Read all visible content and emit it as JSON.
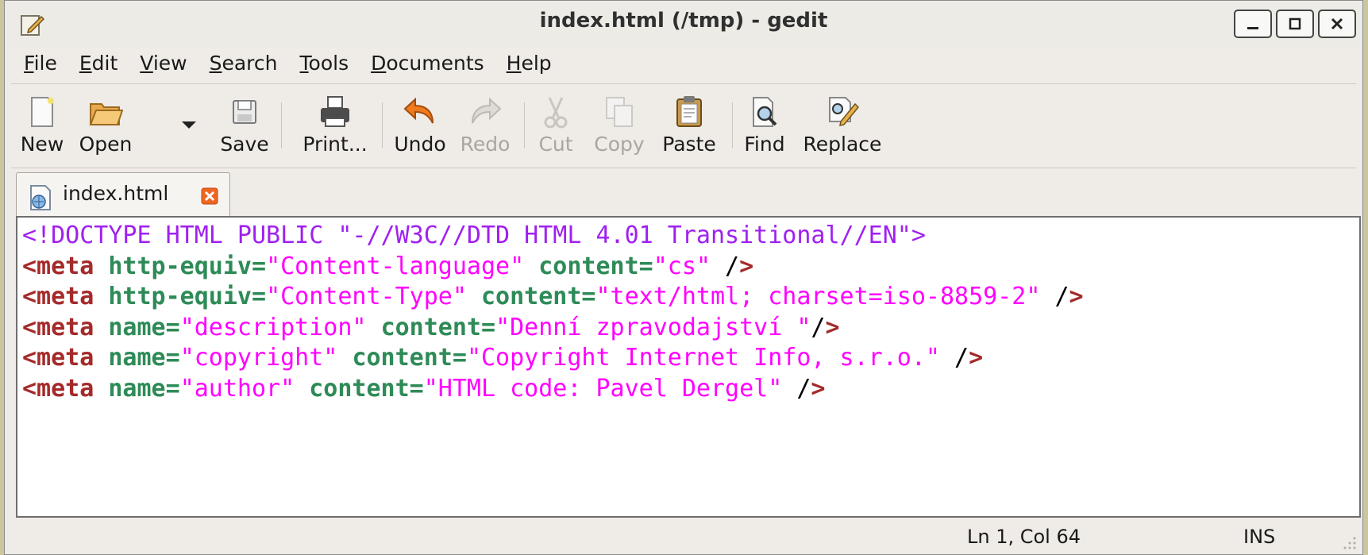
{
  "window": {
    "title": "index.html (/tmp) - gedit"
  },
  "menubar": {
    "items": [
      {
        "pre": "",
        "key": "F",
        "rest": "ile"
      },
      {
        "pre": "",
        "key": "E",
        "rest": "dit"
      },
      {
        "pre": "",
        "key": "V",
        "rest": "iew"
      },
      {
        "pre": "",
        "key": "S",
        "rest": "earch"
      },
      {
        "pre": "",
        "key": "T",
        "rest": "ools"
      },
      {
        "pre": "",
        "key": "D",
        "rest": "ocuments"
      },
      {
        "pre": "",
        "key": "H",
        "rest": "elp"
      }
    ]
  },
  "toolbar": {
    "new": "New",
    "open": "Open",
    "save": "Save",
    "print": "Print...",
    "undo": "Undo",
    "redo": "Redo",
    "cut": "Cut",
    "copy": "Copy",
    "paste": "Paste",
    "find": "Find",
    "replace": "Replace"
  },
  "tabs": [
    {
      "label": "index.html"
    }
  ],
  "editor": {
    "lines": [
      [
        {
          "t": "doc",
          "v": "<!DOCTYPE HTML PUBLIC \"-//W3C//DTD HTML 4.01 Transitional//EN\">"
        }
      ],
      [
        {
          "t": "tag",
          "v": "<meta"
        },
        {
          "t": "p",
          "v": " "
        },
        {
          "t": "attr",
          "v": "http-equiv="
        },
        {
          "t": "str",
          "v": "\"Content-language\""
        },
        {
          "t": "p",
          "v": " "
        },
        {
          "t": "attr",
          "v": "content="
        },
        {
          "t": "str",
          "v": "\"cs\""
        },
        {
          "t": "p",
          "v": " /"
        },
        {
          "t": "tag",
          "v": ">"
        }
      ],
      [
        {
          "t": "tag",
          "v": "<meta"
        },
        {
          "t": "p",
          "v": " "
        },
        {
          "t": "attr",
          "v": "http-equiv="
        },
        {
          "t": "str",
          "v": "\"Content-Type\""
        },
        {
          "t": "p",
          "v": " "
        },
        {
          "t": "attr",
          "v": "content="
        },
        {
          "t": "str",
          "v": "\"text/html; charset=iso-8859-2\""
        },
        {
          "t": "p",
          "v": " /"
        },
        {
          "t": "tag",
          "v": ">"
        }
      ],
      [
        {
          "t": "tag",
          "v": "<meta"
        },
        {
          "t": "p",
          "v": " "
        },
        {
          "t": "attr",
          "v": "name="
        },
        {
          "t": "str",
          "v": "\"description\""
        },
        {
          "t": "p",
          "v": " "
        },
        {
          "t": "attr",
          "v": "content="
        },
        {
          "t": "str",
          "v": "\"Denní zpravodajství \""
        },
        {
          "t": "p",
          "v": "/"
        },
        {
          "t": "tag",
          "v": ">"
        }
      ],
      [
        {
          "t": "tag",
          "v": "<meta"
        },
        {
          "t": "p",
          "v": " "
        },
        {
          "t": "attr",
          "v": "name="
        },
        {
          "t": "str",
          "v": "\"copyright\""
        },
        {
          "t": "p",
          "v": " "
        },
        {
          "t": "attr",
          "v": "content="
        },
        {
          "t": "str",
          "v": "\"Copyright Internet Info, s.r.o.\""
        },
        {
          "t": "p",
          "v": " /"
        },
        {
          "t": "tag",
          "v": ">"
        }
      ],
      [
        {
          "t": "tag",
          "v": "<meta"
        },
        {
          "t": "p",
          "v": " "
        },
        {
          "t": "attr",
          "v": "name="
        },
        {
          "t": "str",
          "v": "\"author\""
        },
        {
          "t": "p",
          "v": " "
        },
        {
          "t": "attr",
          "v": "content="
        },
        {
          "t": "str",
          "v": "\"HTML code: Pavel Dergel\""
        },
        {
          "t": "p",
          "v": " /"
        },
        {
          "t": "tag",
          "v": ">"
        }
      ]
    ]
  },
  "statusbar": {
    "position": "Ln 1, Col 64",
    "mode": "INS"
  },
  "colors": {
    "doctype": "#a020f0",
    "tag": "#a52a2a",
    "attribute": "#2e8b57",
    "string": "#ff00ff"
  }
}
